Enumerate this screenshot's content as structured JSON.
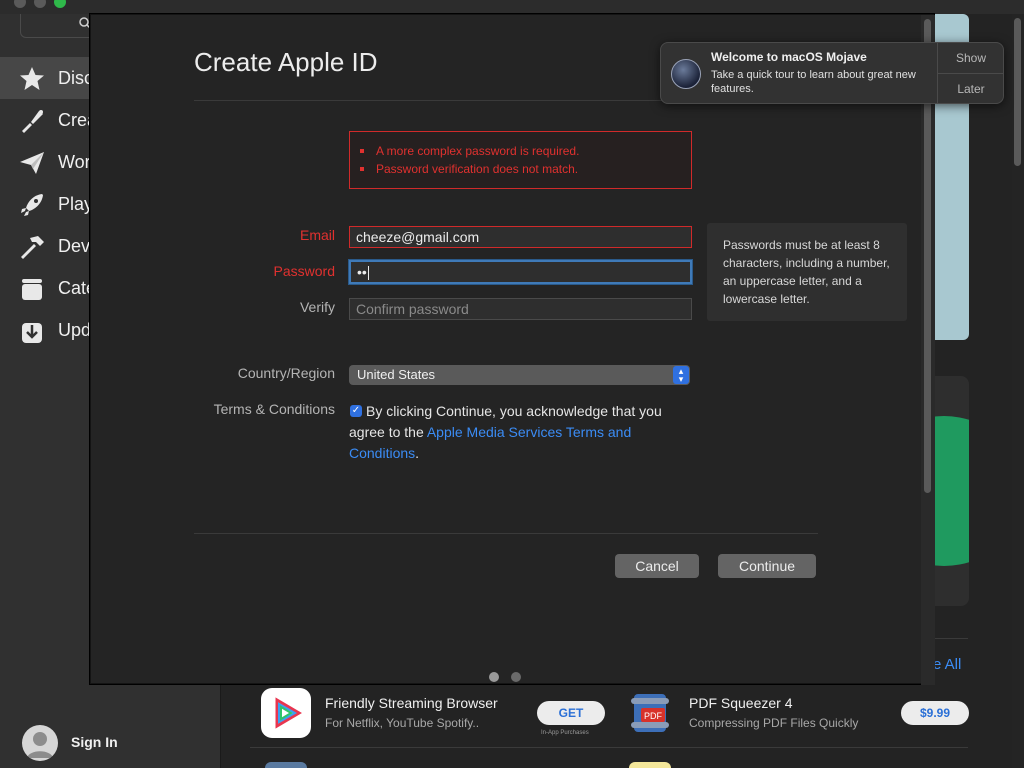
{
  "sidebar": {
    "items": [
      {
        "label": "Discover",
        "icon": "star-icon"
      },
      {
        "label": "Create",
        "icon": "brush-icon"
      },
      {
        "label": "Work",
        "icon": "paper-plane-icon"
      },
      {
        "label": "Play",
        "icon": "rocket-icon"
      },
      {
        "label": "Develop",
        "icon": "hammer-icon"
      },
      {
        "label": "Categories",
        "icon": "categories-icon"
      },
      {
        "label": "Updates",
        "icon": "updates-icon"
      }
    ],
    "sign_in": "Sign In"
  },
  "dialog": {
    "title": "Create Apple ID",
    "errors": [
      "A more complex password is required.",
      "Password verification does not match."
    ],
    "email": {
      "label": "Email",
      "value": "cheeze@gmail.com"
    },
    "password": {
      "label": "Password",
      "value": "••"
    },
    "verify": {
      "label": "Verify",
      "placeholder": "Confirm password"
    },
    "hint": "Passwords must be at least 8 characters, including a number, an uppercase letter, and a lowercase letter.",
    "country": {
      "label": "Country/Region",
      "value": "United States"
    },
    "terms": {
      "label": "Terms & Conditions",
      "text_before": "By clicking Continue, you acknowledge that you agree to the ",
      "link": "Apple Media Services Terms and Conditions",
      "text_after": ".",
      "checked": true
    },
    "buttons": {
      "cancel": "Cancel",
      "continue": "Continue"
    }
  },
  "notification": {
    "title": "Welcome to macOS Mojave",
    "body": "Take a quick tour to learn about great new features.",
    "show": "Show",
    "later": "Later"
  },
  "store": {
    "see_all": "e All",
    "apps": [
      {
        "name": "Friendly Streaming Browser",
        "subtitle": "For Netflix, YouTube Spotify..",
        "button": "GET",
        "note": "In-App Purchases"
      },
      {
        "name": "PDF Squeezer 4",
        "subtitle": "Compressing PDF Files Quickly",
        "button": "$9.99",
        "note": ""
      }
    ]
  },
  "colors": {
    "accent": "#2f70e0",
    "error": "#e0312f",
    "link": "#3b8cf5"
  }
}
